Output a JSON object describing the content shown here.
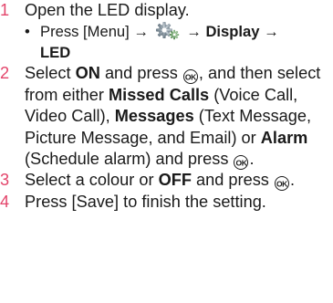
{
  "accent_color": "#e3456b",
  "icons": {
    "settings": "settings-gear-icon",
    "ok": "ok-key-icon"
  },
  "steps": [
    {
      "num": "1",
      "text": "Open the LED display.",
      "sub": {
        "bullet": "•",
        "press": "Press [Menu] →",
        "arrow1": "→",
        "display": "Display",
        "arrow2": "→",
        "led": "LED"
      }
    },
    {
      "num": "2",
      "t1": "Select ",
      "on": "ON",
      "t2": " and press ",
      "t3": ", and then select from either ",
      "missed": "Missed Calls",
      "t4": " (Voice Call, Video Call), ",
      "messages": "Messages",
      "t5": " (Text Message, Picture Message, and Email) or ",
      "alarm": "Alarm",
      "t6": " (Schedule alarm) and press ",
      "t7": "."
    },
    {
      "num": "3",
      "t1": "Select a colour or ",
      "off": "OFF",
      "t2": " and press ",
      "t3": "."
    },
    {
      "num": "4",
      "text": "Press [Save] to finish the setting."
    }
  ],
  "ok_label": "OK"
}
